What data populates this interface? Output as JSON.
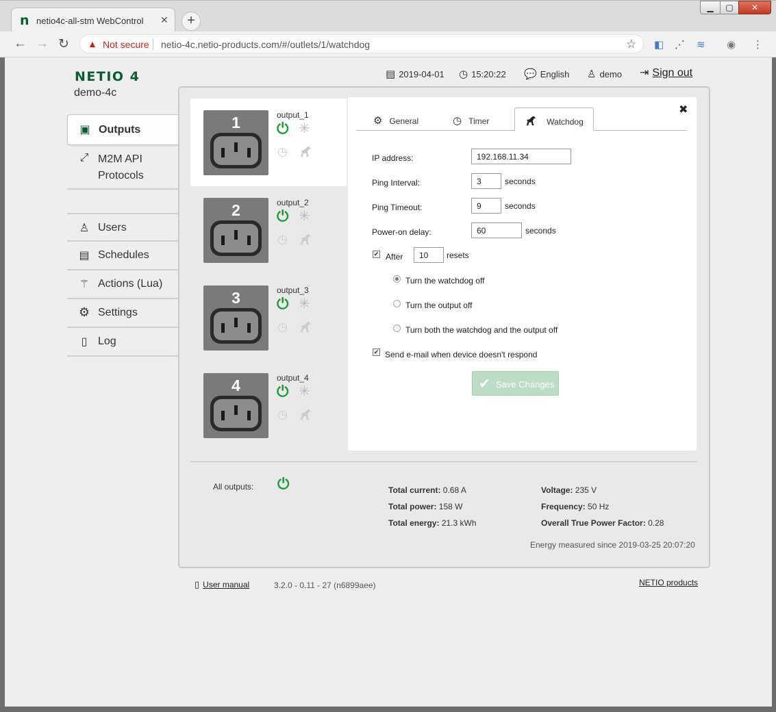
{
  "browser": {
    "tab_title": "netio4c-all-stm WebControl",
    "tab_favicon": "n",
    "not_secure": "Not secure",
    "url": "netio-4c.netio-products.com/#/outlets/1/watchdog"
  },
  "header": {
    "logo": "NETIO 4",
    "device_name": "demo-4c",
    "date": "2019-04-01",
    "time": "15:20:22",
    "language": "English",
    "user": "demo",
    "sign_out": "Sign out"
  },
  "sidebar": {
    "items": [
      {
        "label": "Outputs",
        "icon": "outlet-icon",
        "active": true
      },
      {
        "label": "M2M API",
        "label2": "Protocols",
        "icon": "api-icon"
      },
      {
        "label": "Users",
        "icon": "user-icon"
      },
      {
        "label": "Schedules",
        "icon": "calendar-icon"
      },
      {
        "label": "Actions (Lua)",
        "icon": "magic-wand-icon"
      },
      {
        "label": "Settings",
        "icon": "gear-icon"
      },
      {
        "label": "Log",
        "icon": "document-icon"
      }
    ]
  },
  "outputs": [
    {
      "number": "1",
      "name": "output_1"
    },
    {
      "number": "2",
      "name": "output_2"
    },
    {
      "number": "3",
      "name": "output_3"
    },
    {
      "number": "4",
      "name": "output_4"
    }
  ],
  "detail": {
    "tabs": [
      {
        "label": "General",
        "icon": "gear-icon"
      },
      {
        "label": "Timer",
        "icon": "clock-icon"
      },
      {
        "label": "Watchdog",
        "icon": "dog-icon",
        "active": true
      }
    ],
    "ip_label": "IP address:",
    "ip_value": "192.168.11.34",
    "ping_interval_label": "Ping Interval:",
    "ping_interval_value": "3",
    "ping_timeout_label": "Ping Timeout:",
    "ping_timeout_value": "9",
    "power_on_label": "Power-on delay:",
    "power_on_value": "60",
    "unit_seconds": "seconds",
    "after_label": "After",
    "after_value": "10",
    "resets_label": "resets",
    "after_checked": true,
    "radio_options": [
      {
        "label": "Turn the watchdog off",
        "selected": true
      },
      {
        "label": "Turn the output off",
        "selected": false
      },
      {
        "label": "Turn both the watchdog and the output off",
        "selected": false
      }
    ],
    "email_label": "Send e-mail when device doesn't respond",
    "email_checked": true,
    "save_label": "Save Changes"
  },
  "summary": {
    "all_outputs_label": "All outputs:",
    "total_current_label": "Total current:",
    "total_current_value": "0.68 A",
    "total_power_label": "Total power:",
    "total_power_value": "158 W",
    "total_energy_label": "Total energy:",
    "total_energy_value": "21.3 kWh",
    "voltage_label": "Voltage:",
    "voltage_value": "235 V",
    "frequency_label": "Frequency:",
    "frequency_value": "50 Hz",
    "tpf_label": "Overall True Power Factor:",
    "tpf_value": "0.28",
    "energy_since": "Energy measured since 2019-03-25 20:07:20"
  },
  "footer": {
    "user_manual": "User manual",
    "version": "3.2.0 - 0.11 - 27 (n6899aee)",
    "products": "NETIO products"
  },
  "colors": {
    "brand": "#0d5b34",
    "power_on": "#1f9a3d",
    "save_disabled": "#bcdcc6"
  }
}
